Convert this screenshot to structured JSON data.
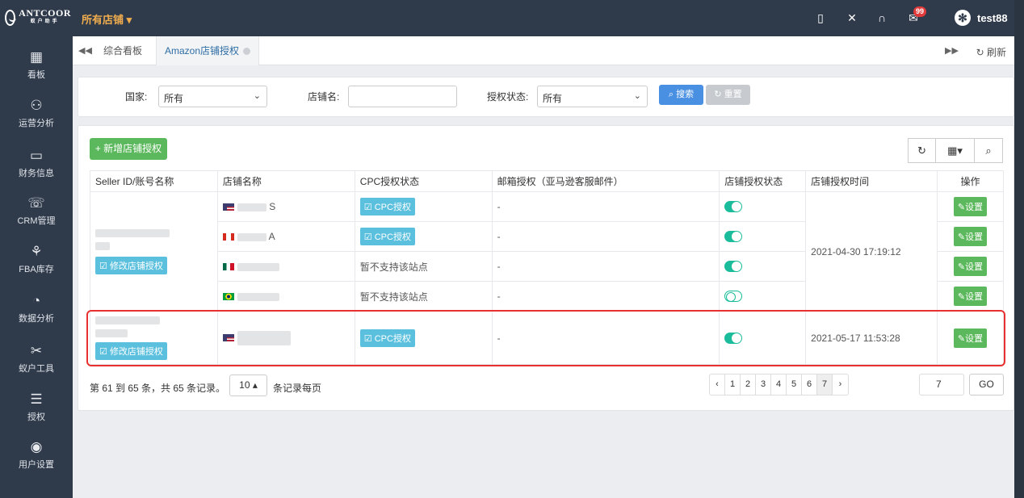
{
  "topbar": {
    "logo_text": "ANTCOOR",
    "logo_sub": "蚁户助手",
    "store_selector": "所有店铺 ▾",
    "mail_badge": "99",
    "username": "test88"
  },
  "sidebar": {
    "items": [
      {
        "label": "看板",
        "icon": "dashboard-icon"
      },
      {
        "label": "运营分析",
        "icon": "operations-icon"
      },
      {
        "label": "财务信息",
        "icon": "finance-icon"
      },
      {
        "label": "CRM管理",
        "icon": "crm-icon"
      },
      {
        "label": "FBA库存",
        "icon": "inventory-icon"
      },
      {
        "label": "数据分析",
        "icon": "data-analysis-icon"
      },
      {
        "label": "蚁户工具",
        "icon": "tools-icon"
      },
      {
        "label": "授权",
        "icon": "authorization-icon"
      },
      {
        "label": "用户设置",
        "icon": "user-settings-icon"
      }
    ]
  },
  "tabs": {
    "items": [
      {
        "label": "综合看板"
      },
      {
        "label": "Amazon店铺授权"
      }
    ],
    "refresh": "刷新"
  },
  "filters": {
    "country_label": "国家:",
    "country_value": "所有",
    "store_label": "店铺名:",
    "auth_label": "授权状态:",
    "auth_value": "所有",
    "search": "搜索",
    "reset": "重置"
  },
  "panel": {
    "add_button": "新增店铺授权"
  },
  "table": {
    "headers": [
      "Seller ID/账号名称",
      "店铺名称",
      "CPC授权状态",
      "邮箱授权（亚马逊客服邮件）",
      "店铺授权状态",
      "店铺授权时间",
      "操作"
    ],
    "edit_label": "修改店铺授权",
    "set_label": "设置",
    "cpc_label": "CPC授权",
    "unsupported": "暂不支持该站点",
    "dash": "-",
    "store_suffixes": [
      "S",
      "A",
      "",
      "",
      ""
    ],
    "times": [
      "2021-04-30 17:19:12",
      "2021-05-17 11:53:28"
    ]
  },
  "pager": {
    "summary": "第 61 到 65 条，共 65 条记录。",
    "page_size": "10 ▴",
    "per_page": "条记录每页",
    "pages": [
      "‹",
      "1",
      "2",
      "3",
      "4",
      "5",
      "6",
      "7",
      "›"
    ],
    "goto_value": "7",
    "go": "GO"
  },
  "colors": {
    "sidebar_bg": "#2f3a4b",
    "accent_green": "#5cb85c",
    "accent_cyan": "#5bc0de",
    "toggle_on": "#1abc9c",
    "highlight_red": "#e83030"
  }
}
